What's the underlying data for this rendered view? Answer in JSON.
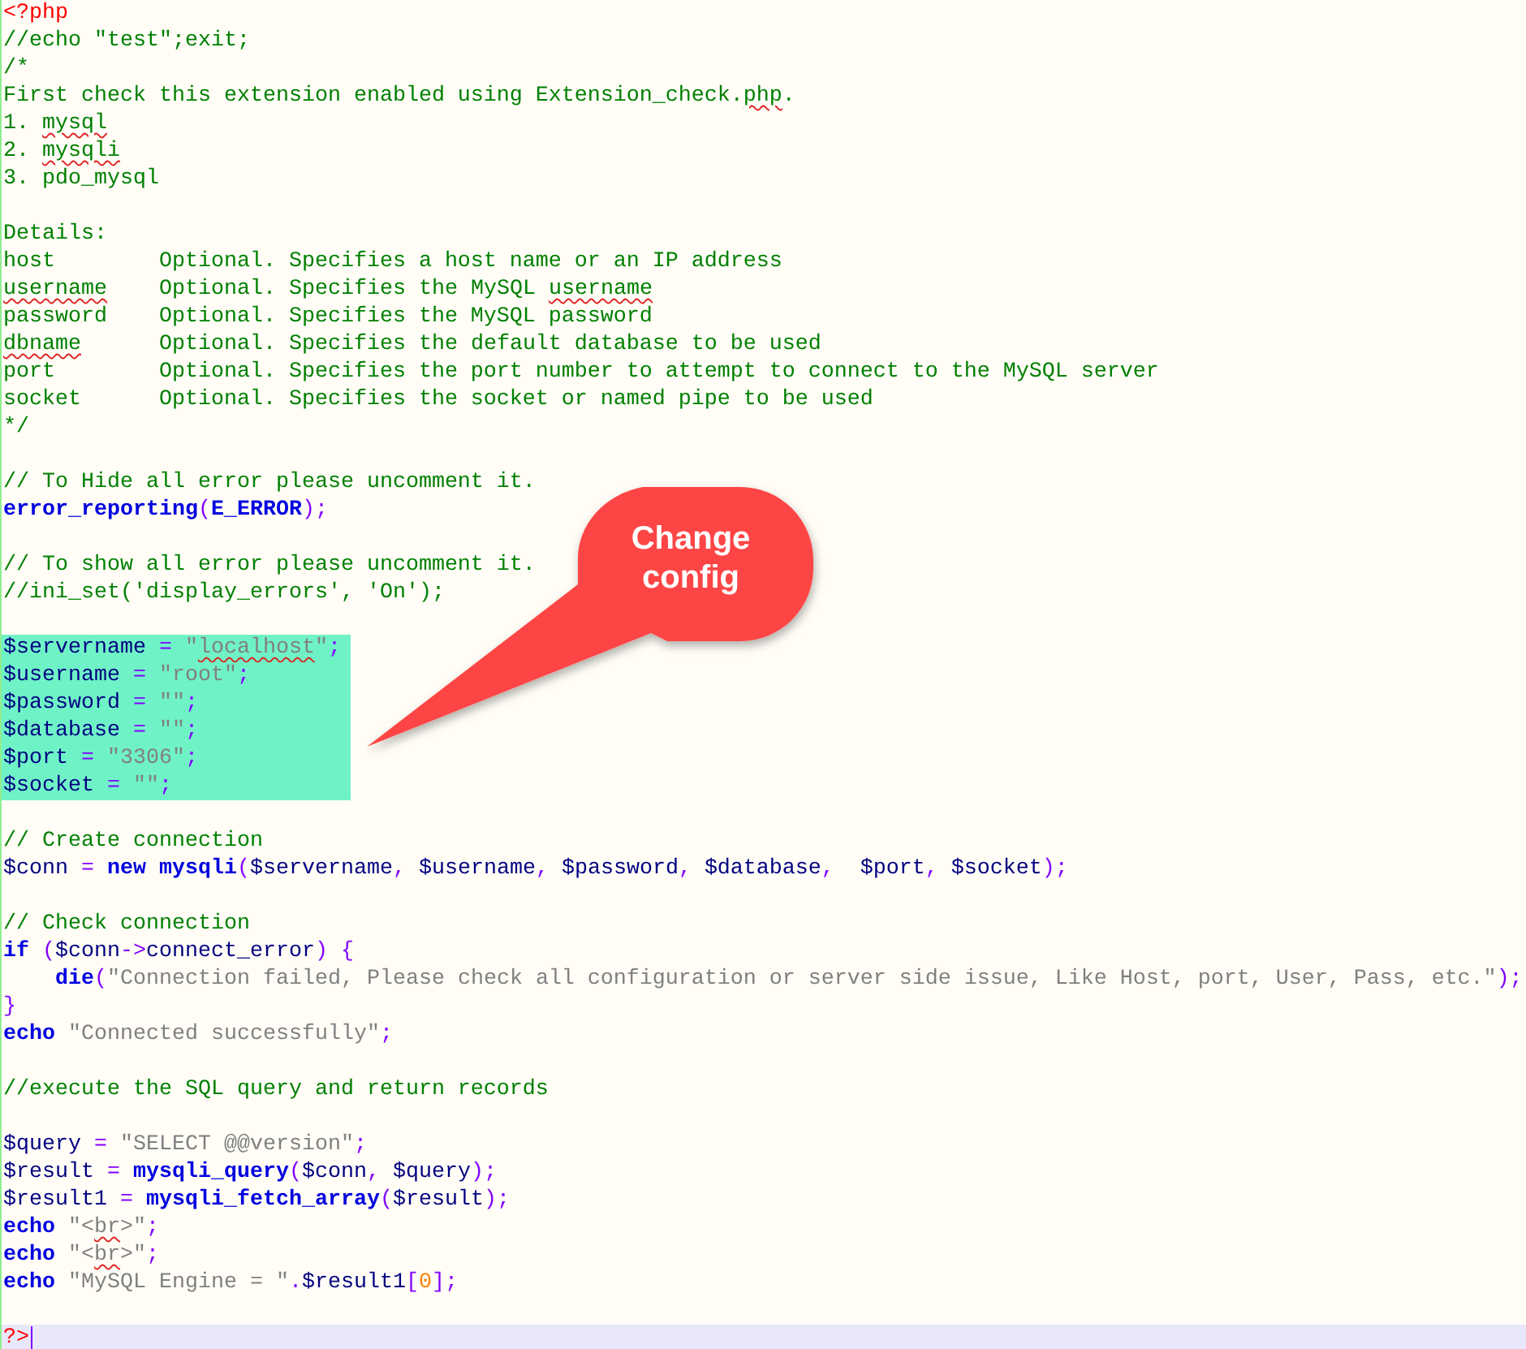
{
  "editor": {
    "blocks": [
      {
        "lines": [
          {
            "tokens": [
              {
                "kind": "tag",
                "text": "<?php"
              }
            ]
          },
          {
            "tokens": [
              {
                "kind": "comment",
                "text": "//echo \"test\";exit;"
              }
            ]
          },
          {
            "tokens": [
              {
                "kind": "comment",
                "text": "/*"
              }
            ]
          },
          {
            "tokens": [
              {
                "kind": "comment",
                "text": "First check this extension enabled using Extension_check."
              },
              {
                "kind": "comment",
                "text": "php",
                "misspelled": true
              },
              {
                "kind": "comment",
                "text": "."
              }
            ]
          },
          {
            "tokens": [
              {
                "kind": "comment",
                "text": "1. "
              },
              {
                "kind": "comment",
                "text": "mysql",
                "misspelled": true
              }
            ]
          },
          {
            "tokens": [
              {
                "kind": "comment",
                "text": "2. "
              },
              {
                "kind": "comment",
                "text": "mysqli",
                "misspelled": true
              }
            ]
          },
          {
            "tokens": [
              {
                "kind": "comment",
                "text": "3. pdo_mysql"
              }
            ]
          }
        ]
      },
      {
        "lines": [
          {
            "tokens": [
              {
                "kind": "comment",
                "text": "Details:"
              }
            ]
          },
          {
            "tokens": [
              {
                "kind": "comment",
                "text": "host        Optional. Specifies a host name or an IP address"
              }
            ]
          },
          {
            "tokens": [
              {
                "kind": "comment",
                "text": "username",
                "misspelled": true
              },
              {
                "kind": "comment",
                "text": "    Optional. Specifies the MySQL "
              },
              {
                "kind": "comment",
                "text": "username",
                "misspelled": true
              }
            ]
          },
          {
            "tokens": [
              {
                "kind": "comment",
                "text": "password    Optional. Specifies the MySQL password"
              }
            ]
          },
          {
            "tokens": [
              {
                "kind": "comment",
                "text": "dbname",
                "misspelled": true
              },
              {
                "kind": "comment",
                "text": "      Optional. Specifies the default database to be used"
              }
            ]
          },
          {
            "tokens": [
              {
                "kind": "comment",
                "text": "port        Optional. Specifies the port number to attempt to connect to the MySQL server"
              }
            ]
          },
          {
            "tokens": [
              {
                "kind": "comment",
                "text": "socket      Optional. Specifies the socket or named pipe to be used"
              }
            ]
          },
          {
            "tokens": [
              {
                "kind": "comment",
                "text": "*/"
              }
            ]
          }
        ]
      },
      {
        "lines": [
          {
            "tokens": [
              {
                "kind": "comment",
                "text": "// To Hide all error please uncomment it."
              }
            ]
          },
          {
            "tokens": [
              {
                "kind": "keyword",
                "text": "error_reporting"
              },
              {
                "kind": "operator",
                "text": "("
              },
              {
                "kind": "keyword",
                "text": "E_ERROR"
              },
              {
                "kind": "operator",
                "text": ");"
              }
            ]
          }
        ]
      },
      {
        "lines": [
          {
            "tokens": [
              {
                "kind": "comment",
                "text": "// To show all error please uncomment it."
              }
            ]
          },
          {
            "tokens": [
              {
                "kind": "comment",
                "text": "//ini_set('display_errors', 'On');"
              }
            ]
          }
        ]
      },
      {
        "highlighted": true,
        "lines": [
          {
            "tokens": [
              {
                "kind": "variable",
                "text": "$servername"
              },
              {
                "kind": "operator",
                "text": " = "
              },
              {
                "kind": "string",
                "text": "\""
              },
              {
                "kind": "string",
                "text": "localhost",
                "misspelled": true
              },
              {
                "kind": "string",
                "text": "\""
              },
              {
                "kind": "operator",
                "text": ";"
              }
            ]
          },
          {
            "tokens": [
              {
                "kind": "variable",
                "text": "$username"
              },
              {
                "kind": "operator",
                "text": " = "
              },
              {
                "kind": "string",
                "text": "\"root\""
              },
              {
                "kind": "operator",
                "text": ";"
              }
            ]
          },
          {
            "tokens": [
              {
                "kind": "variable",
                "text": "$password"
              },
              {
                "kind": "operator",
                "text": " = "
              },
              {
                "kind": "string",
                "text": "\"\""
              },
              {
                "kind": "operator",
                "text": ";"
              }
            ]
          },
          {
            "tokens": [
              {
                "kind": "variable",
                "text": "$database"
              },
              {
                "kind": "operator",
                "text": " = "
              },
              {
                "kind": "string",
                "text": "\"\""
              },
              {
                "kind": "operator",
                "text": ";"
              }
            ]
          },
          {
            "tokens": [
              {
                "kind": "variable",
                "text": "$port"
              },
              {
                "kind": "operator",
                "text": " = "
              },
              {
                "kind": "string",
                "text": "\"3306\""
              },
              {
                "kind": "operator",
                "text": ";"
              }
            ]
          },
          {
            "tokens": [
              {
                "kind": "variable",
                "text": "$socket"
              },
              {
                "kind": "operator",
                "text": " = "
              },
              {
                "kind": "string",
                "text": "\"\""
              },
              {
                "kind": "operator",
                "text": ";"
              }
            ]
          }
        ]
      },
      {
        "lines": [
          {
            "tokens": [
              {
                "kind": "comment",
                "text": "// Create connection"
              }
            ]
          },
          {
            "tokens": [
              {
                "kind": "variable",
                "text": "$conn"
              },
              {
                "kind": "operator",
                "text": " = "
              },
              {
                "kind": "keyword",
                "text": "new mysqli"
              },
              {
                "kind": "operator",
                "text": "("
              },
              {
                "kind": "variable",
                "text": "$servername"
              },
              {
                "kind": "operator",
                "text": ", "
              },
              {
                "kind": "variable",
                "text": "$username"
              },
              {
                "kind": "operator",
                "text": ", "
              },
              {
                "kind": "variable",
                "text": "$password"
              },
              {
                "kind": "operator",
                "text": ", "
              },
              {
                "kind": "variable",
                "text": "$database"
              },
              {
                "kind": "operator",
                "text": ",  "
              },
              {
                "kind": "variable",
                "text": "$port"
              },
              {
                "kind": "operator",
                "text": ", "
              },
              {
                "kind": "variable",
                "text": "$socket"
              },
              {
                "kind": "operator",
                "text": ");"
              }
            ]
          }
        ]
      },
      {
        "lines": [
          {
            "tokens": [
              {
                "kind": "comment",
                "text": "// Check connection"
              }
            ]
          },
          {
            "tokens": [
              {
                "kind": "keyword",
                "text": "if"
              },
              {
                "kind": "operator",
                "text": " ("
              },
              {
                "kind": "variable",
                "text": "$conn"
              },
              {
                "kind": "operator",
                "text": "->"
              },
              {
                "kind": "variable",
                "text": "connect_error"
              },
              {
                "kind": "operator",
                "text": ") {"
              }
            ]
          },
          {
            "tokens": [
              {
                "kind": "keyword",
                "text": "    die"
              },
              {
                "kind": "operator",
                "text": "("
              },
              {
                "kind": "string",
                "text": "\"Connection failed, Please check all configuration or server side issue, Like Host, port, User, Pass, etc.\""
              },
              {
                "kind": "operator",
                "text": ");"
              }
            ]
          },
          {
            "tokens": [
              {
                "kind": "operator",
                "text": "}"
              }
            ]
          },
          {
            "tokens": [
              {
                "kind": "keyword",
                "text": "echo"
              },
              {
                "kind": "string",
                "text": " \"Connected successfully\""
              },
              {
                "kind": "operator",
                "text": ";"
              }
            ]
          }
        ]
      },
      {
        "lines": [
          {
            "tokens": [
              {
                "kind": "comment",
                "text": "//execute the SQL query and return records"
              }
            ]
          }
        ]
      },
      {
        "lines": [
          {
            "tokens": [
              {
                "kind": "variable",
                "text": "$query"
              },
              {
                "kind": "operator",
                "text": " = "
              },
              {
                "kind": "string",
                "text": "\"SELECT @@version\""
              },
              {
                "kind": "operator",
                "text": ";"
              }
            ]
          },
          {
            "tokens": [
              {
                "kind": "variable",
                "text": "$result"
              },
              {
                "kind": "operator",
                "text": " = "
              },
              {
                "kind": "keyword",
                "text": "mysqli_query"
              },
              {
                "kind": "operator",
                "text": "("
              },
              {
                "kind": "variable",
                "text": "$conn"
              },
              {
                "kind": "operator",
                "text": ", "
              },
              {
                "kind": "variable",
                "text": "$query"
              },
              {
                "kind": "operator",
                "text": ");"
              }
            ]
          },
          {
            "tokens": [
              {
                "kind": "variable",
                "text": "$result1"
              },
              {
                "kind": "operator",
                "text": " = "
              },
              {
                "kind": "keyword",
                "text": "mysqli_fetch_array"
              },
              {
                "kind": "operator",
                "text": "("
              },
              {
                "kind": "variable",
                "text": "$result"
              },
              {
                "kind": "operator",
                "text": ");"
              }
            ]
          },
          {
            "tokens": [
              {
                "kind": "keyword",
                "text": "echo"
              },
              {
                "kind": "string",
                "text": " \"<"
              },
              {
                "kind": "string",
                "text": "br",
                "misspelled": true
              },
              {
                "kind": "string",
                "text": ">\""
              },
              {
                "kind": "operator",
                "text": ";"
              }
            ]
          },
          {
            "tokens": [
              {
                "kind": "keyword",
                "text": "echo"
              },
              {
                "kind": "string",
                "text": " \"<"
              },
              {
                "kind": "string",
                "text": "br",
                "misspelled": true
              },
              {
                "kind": "string",
                "text": ">\""
              },
              {
                "kind": "operator",
                "text": ";"
              }
            ]
          },
          {
            "tokens": [
              {
                "kind": "keyword",
                "text": "echo"
              },
              {
                "kind": "string",
                "text": " \"MySQL Engine = \""
              },
              {
                "kind": "operator",
                "text": "."
              },
              {
                "kind": "variable",
                "text": "$result1"
              },
              {
                "kind": "operator",
                "text": "["
              },
              {
                "kind": "number",
                "text": "0"
              },
              {
                "kind": "operator",
                "text": "];"
              }
            ]
          }
        ]
      },
      {
        "lines": [
          {
            "current": true,
            "tokens": [
              {
                "kind": "tag",
                "text": "?>"
              }
            ]
          }
        ]
      }
    ]
  },
  "callout": {
    "text": "Change config"
  }
}
